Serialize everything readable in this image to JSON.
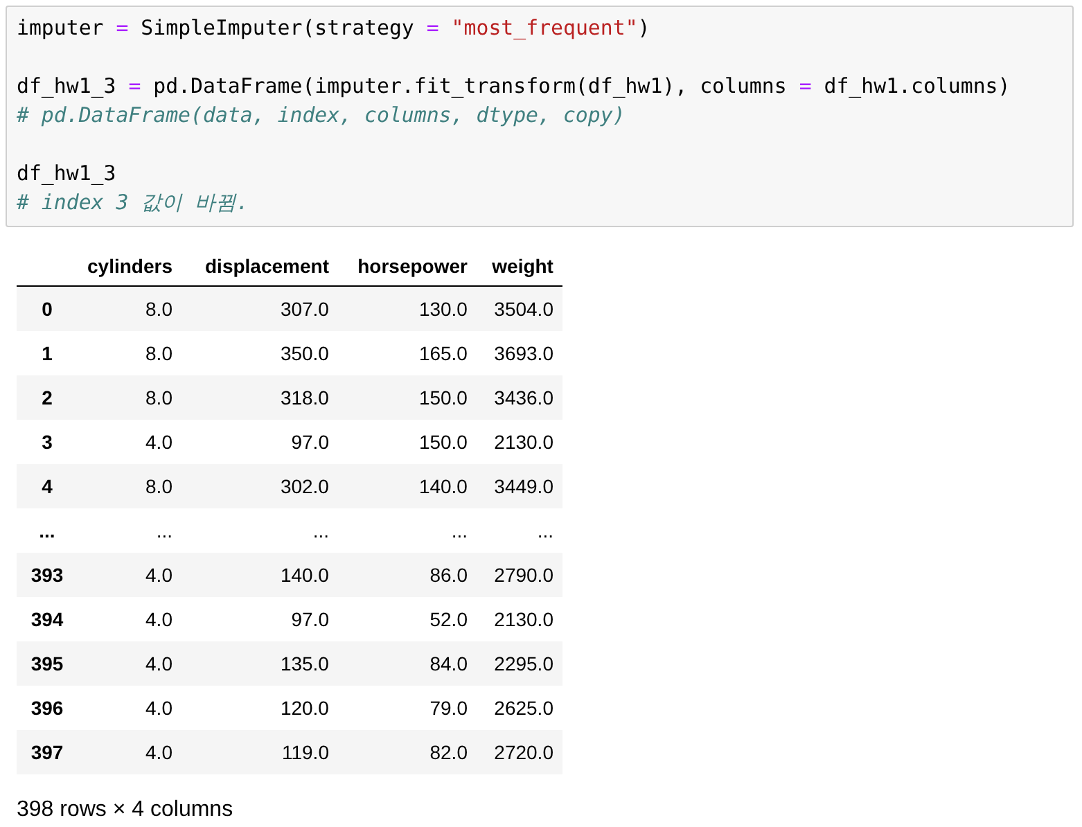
{
  "code_cell": {
    "lines": [
      {
        "space_before": false,
        "tokens": [
          {
            "text": "imputer ",
            "kind": "plain"
          },
          {
            "text": "=",
            "kind": "operator"
          },
          {
            "text": " SimpleImputer(strategy ",
            "kind": "plain"
          },
          {
            "text": "=",
            "kind": "operator"
          },
          {
            "text": " \"most_frequent\"",
            "kind": "string"
          },
          {
            "text": ")",
            "kind": "plain"
          }
        ]
      },
      {
        "space_before": true,
        "tokens": [
          {
            "text": "df_hw1_3 ",
            "kind": "plain"
          },
          {
            "text": "=",
            "kind": "operator"
          },
          {
            "text": " pd.DataFrame(imputer.fit_transform(df_hw1), columns ",
            "kind": "plain"
          },
          {
            "text": "=",
            "kind": "operator"
          },
          {
            "text": " df_hw1.columns)",
            "kind": "plain"
          }
        ]
      },
      {
        "space_before": false,
        "tokens": [
          {
            "text": "# pd.DataFrame(data, index, columns, dtype, copy)",
            "kind": "comment"
          }
        ]
      },
      {
        "space_before": true,
        "tokens": [
          {
            "text": "df_hw1_3",
            "kind": "plain"
          }
        ]
      },
      {
        "space_before": false,
        "tokens": [
          {
            "text": "# index 3 값이 바뀜.",
            "kind": "comment"
          }
        ]
      }
    ]
  },
  "table": {
    "columns": [
      "cylinders",
      "displacement",
      "horsepower",
      "weight"
    ],
    "rows": [
      {
        "index": "0",
        "cells": [
          "8.0",
          "307.0",
          "130.0",
          "3504.0"
        ]
      },
      {
        "index": "1",
        "cells": [
          "8.0",
          "350.0",
          "165.0",
          "3693.0"
        ]
      },
      {
        "index": "2",
        "cells": [
          "8.0",
          "318.0",
          "150.0",
          "3436.0"
        ]
      },
      {
        "index": "3",
        "cells": [
          "4.0",
          "97.0",
          "150.0",
          "2130.0"
        ]
      },
      {
        "index": "4",
        "cells": [
          "8.0",
          "302.0",
          "140.0",
          "3449.0"
        ]
      },
      {
        "index": "...",
        "cells": [
          "...",
          "...",
          "...",
          "..."
        ]
      },
      {
        "index": "393",
        "cells": [
          "4.0",
          "140.0",
          "86.0",
          "2790.0"
        ]
      },
      {
        "index": "394",
        "cells": [
          "4.0",
          "97.0",
          "52.0",
          "2130.0"
        ]
      },
      {
        "index": "395",
        "cells": [
          "4.0",
          "135.0",
          "84.0",
          "2295.0"
        ]
      },
      {
        "index": "396",
        "cells": [
          "4.0",
          "120.0",
          "79.0",
          "2625.0"
        ]
      },
      {
        "index": "397",
        "cells": [
          "4.0",
          "119.0",
          "82.0",
          "2720.0"
        ]
      }
    ]
  },
  "shape_note": "398 rows × 4 columns"
}
